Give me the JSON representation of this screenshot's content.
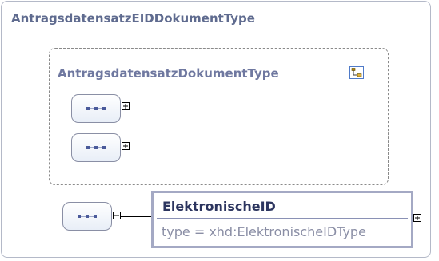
{
  "complex_type": {
    "title": "AntragsdatensatzEIDDokumentType"
  },
  "base_type": {
    "title": "AntragsdatensatzDokumentType",
    "icon": "type-hierarchy-icon"
  },
  "sequences": [
    {
      "icon": "sequence-icon",
      "toggle": "expand"
    },
    {
      "icon": "sequence-icon",
      "toggle": "expand"
    },
    {
      "icon": "sequence-icon",
      "toggle": "collapse"
    }
  ],
  "element": {
    "name": "ElektronischeID",
    "type": "type = xhd:ElektronischeIDType",
    "toggle": "expand"
  },
  "colors": {
    "title": "#5f6b8f",
    "element_border": "#a4a9c4",
    "element_name": "#2c355f",
    "element_type": "#8a8ea5"
  }
}
